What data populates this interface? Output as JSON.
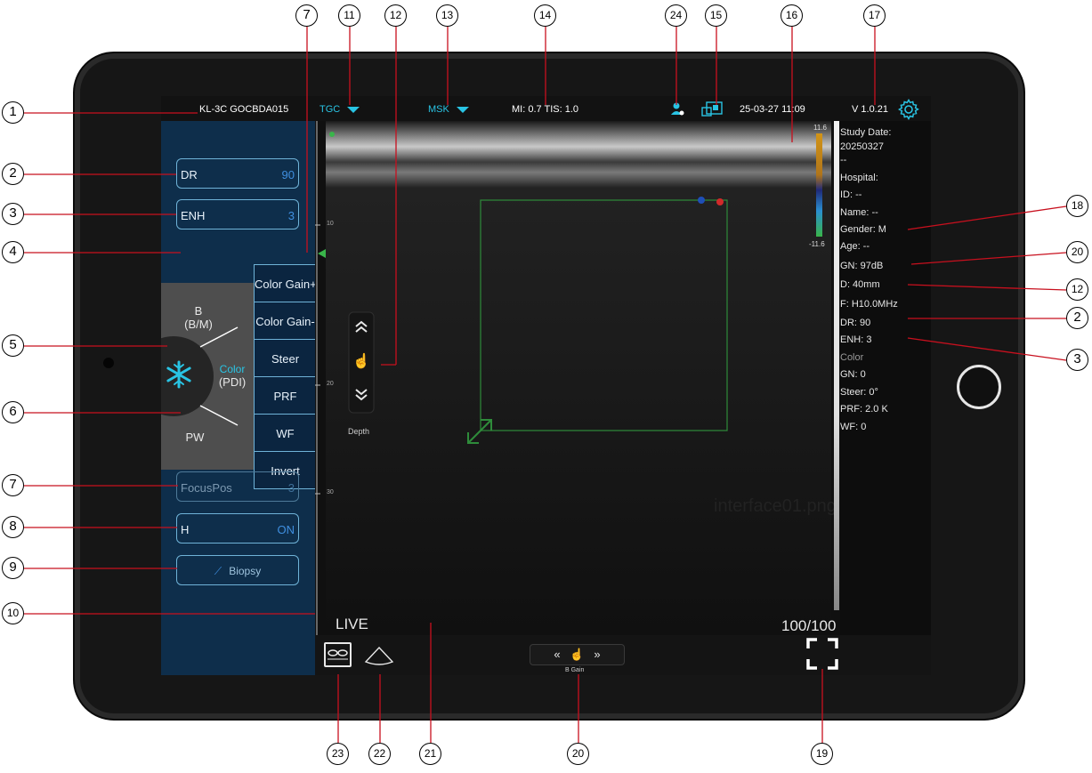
{
  "topbar": {
    "device": "KL-3C GOCBDA015",
    "tgc": "TGC",
    "preset": "MSK",
    "mi_tis": "MI: 0.7 TIS: 1.0",
    "datetime": "25-03-27 11:09",
    "version": "V 1.0.21"
  },
  "left": {
    "dr": {
      "label": "DR",
      "value": "90"
    },
    "enh": {
      "label": "ENH",
      "value": "3"
    },
    "focus": {
      "label": "FocusPos",
      "value": "3"
    },
    "h": {
      "label": "H",
      "value": "ON"
    },
    "biopsy": "Biopsy"
  },
  "modes": {
    "b": "B",
    "bm": "(B/M)",
    "color": "Color",
    "pdi": "(PDI)",
    "pw": "PW"
  },
  "submenu": [
    "Color Gain+",
    "Color Gain-",
    "Steer",
    "PRF",
    "WF",
    "Invert"
  ],
  "image": {
    "scale_ticks": [
      "10",
      "20",
      "30"
    ],
    "depth_label": "Depth",
    "live": "LIVE",
    "frames": "100/100",
    "colorbar_max": "11.6",
    "colorbar_min": "-11.6",
    "watermark": "interface01.png"
  },
  "bottom": {
    "bgain": "B Gain"
  },
  "info": [
    "Study Date:",
    "20250327",
    "--",
    "Hospital:",
    "ID: --",
    "Name: --",
    "Gender: M",
    "Age: --",
    "GN: 97dB",
    "D: 40mm",
    "F: H10.0MHz",
    "DR: 90",
    "ENH: 3",
    "Color",
    "GN: 0",
    "Steer: 0°",
    "PRF: 2.0 K",
    "WF: 0"
  ],
  "callouts": {
    "left": [
      "1",
      "2",
      "3",
      "4",
      "5",
      "6",
      "7",
      "8",
      "9",
      "10"
    ],
    "top": [
      "7",
      "11",
      "12",
      "13",
      "14",
      "24",
      "15",
      "16",
      "17"
    ],
    "right": [
      "18",
      "20",
      "12",
      "2",
      "3"
    ],
    "bottom": [
      "23",
      "22",
      "21",
      "20",
      "19"
    ]
  }
}
